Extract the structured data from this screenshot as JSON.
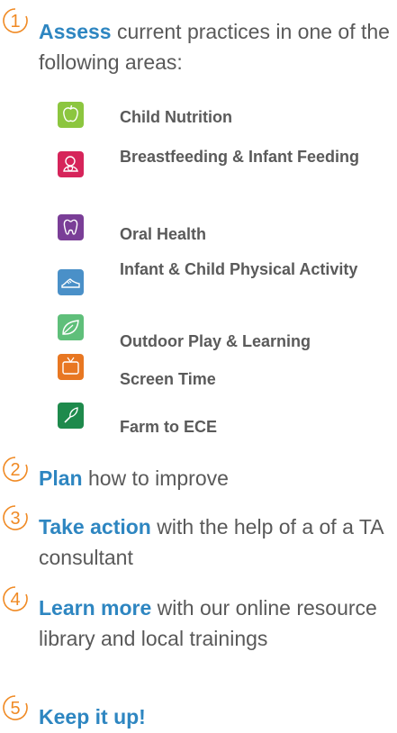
{
  "steps": [
    {
      "num": "1",
      "keyword": "Assess",
      "rest": " current practices in one of the following areas:"
    },
    {
      "num": "2",
      "keyword": "Plan",
      "rest": " how to improve"
    },
    {
      "num": "3",
      "keyword": "Take action",
      "rest": " with the help of a of a TA consultant"
    },
    {
      "num": "4",
      "keyword": "Learn more",
      "rest": " with our online resource library and local trainings"
    },
    {
      "num": "5",
      "keyword": "Keep it up!",
      "rest": ""
    }
  ],
  "areas": [
    {
      "label": "Child Nutrition",
      "icon": "apple-icon",
      "color": "#8cc63f"
    },
    {
      "label": "Breastfeeding & Infant Feeding",
      "icon": "mother-baby-icon",
      "color": "#d6245a"
    },
    {
      "label": "Oral Health",
      "icon": "tooth-icon",
      "color": "#7a3e97"
    },
    {
      "label": "Infant & Child Physical Activity",
      "icon": "sneaker-icon",
      "color": "#4a90c8"
    },
    {
      "label": "Outdoor Play & Learning",
      "icon": "leaf-icon",
      "color": "#5fbf7a"
    },
    {
      "label": "Screen Time",
      "icon": "tv-icon",
      "color": "#e87722"
    },
    {
      "label": "Farm to ECE",
      "icon": "trowel-icon",
      "color": "#1e8a4c"
    }
  ],
  "colors": {
    "accent": "#2e86c1",
    "circle_outline": "#e87722",
    "text": "#595959"
  }
}
